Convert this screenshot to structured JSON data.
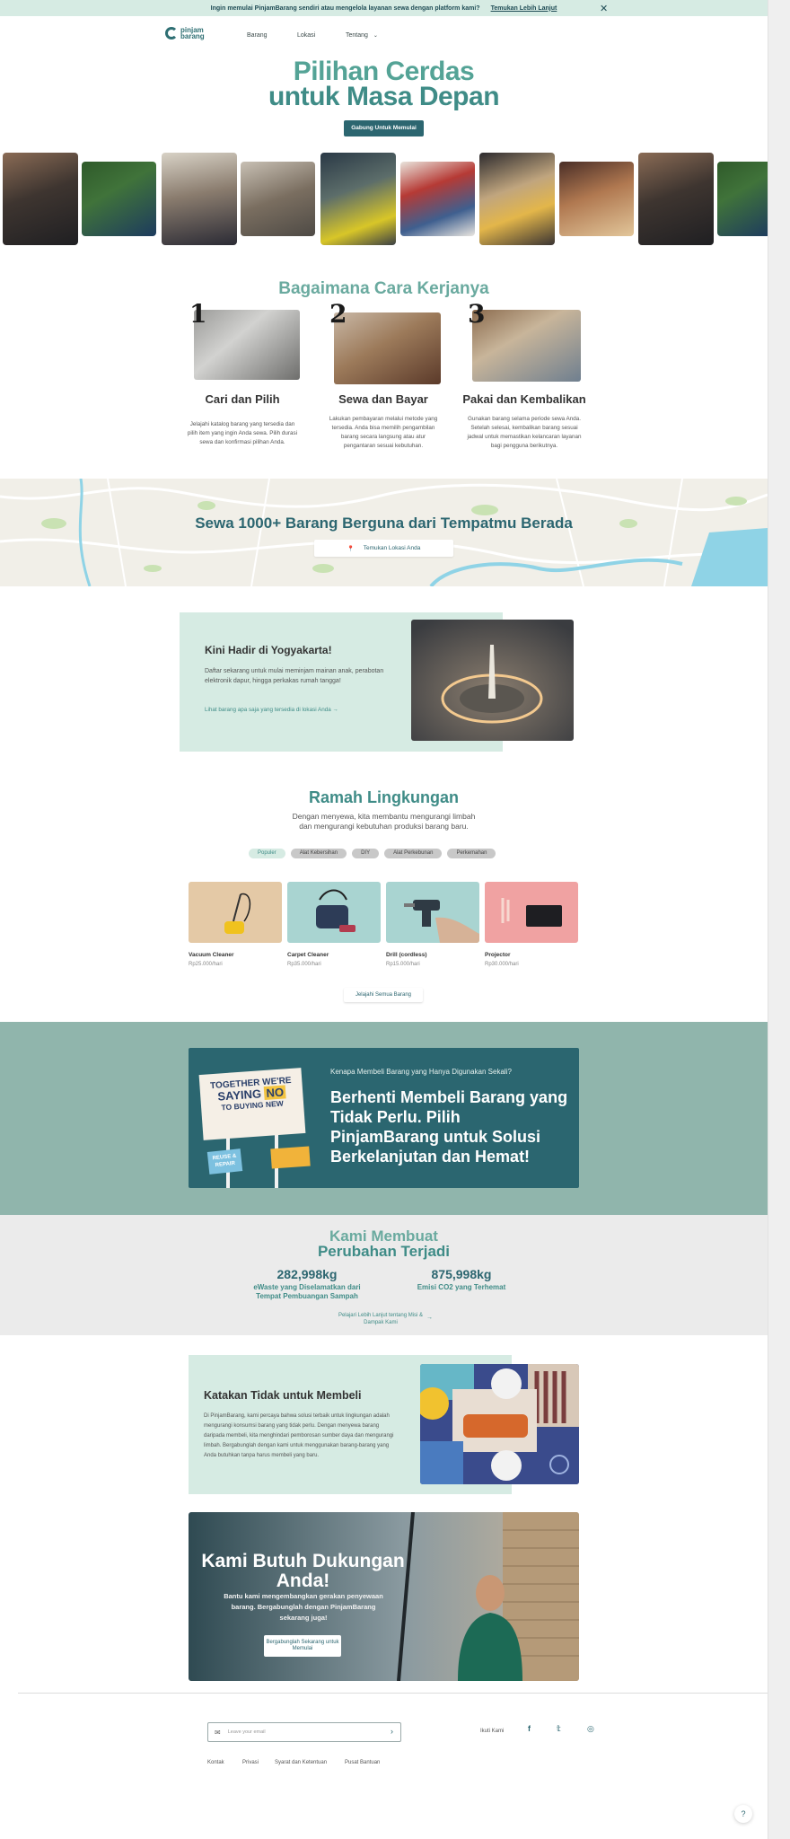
{
  "banner": {
    "text": "Ingin memulai PinjamBarang sendiri atau mengelola layanan sewa dengan platform kami?",
    "link": "Temukan Lebih Lanjut",
    "close_icon": "close-icon"
  },
  "nav": {
    "logo_line1": "pinjam",
    "logo_line2": "barang",
    "items": [
      "Barang",
      "Lokasi",
      "Tentang"
    ]
  },
  "hero": {
    "title_line1": "Pilihan Cerdas",
    "title_line2": "untuk Masa Depan",
    "cta": "Gabung Untuk Memulai"
  },
  "how": {
    "title": "Bagaimana Cara Kerjanya",
    "steps": [
      {
        "num": "1",
        "title": "Cari dan Pilih",
        "desc": "Jelajahi katalog barang yang tersedia dan pilih item yang ingin Anda sewa. Pilih durasi sewa dan konfirmasi pilihan Anda."
      },
      {
        "num": "2",
        "title": "Sewa dan Bayar",
        "desc": "Lakukan pembayaran melalui metode yang tersedia. Anda bisa memilih pengambilan barang secara langsung atau atur pengantaran sesuai kebutuhan."
      },
      {
        "num": "3",
        "title": "Pakai dan Kembalikan",
        "desc": "Gunakan barang selama periode sewa Anda. Setelah selesai, kembalikan barang sesuai jadwal untuk memastikan kelancaran layanan bagi pengguna berikutnya."
      }
    ]
  },
  "map": {
    "title": "Sewa 1000+ Barang Berguna dari Tempatmu Berada",
    "button": "Temukan Lokasi Anda"
  },
  "jogja": {
    "title": "Kini Hadir di Yogyakarta!",
    "desc": "Daftar sekarang untuk mulai meminjam mainan anak, perabotan elektronik dapur, hingga perkakas rumah tangga!",
    "link": "Lihat barang apa saja yang tersedia di lokasi Anda"
  },
  "ramah": {
    "title": "Ramah Lingkungan",
    "subtitle_line1": "Dengan menyewa, kita membantu mengurangi limbah",
    "subtitle_line2": "dan mengurangi kebutuhan produksi barang baru.",
    "filters": [
      "Populer",
      "Alat Kebersihan",
      "DIY",
      "Alat Perkebunan",
      "Perkemahan"
    ],
    "products": [
      {
        "name": "Vacuum Cleaner",
        "price": "Rp25.000/hari"
      },
      {
        "name": "Carpet Cleaner",
        "price": "Rp35.000/hari"
      },
      {
        "name": "Drill (cordless)",
        "price": "Rp15.000/hari"
      },
      {
        "name": "Projector",
        "price": "Rp30.000/hari"
      }
    ],
    "button": "Jelajahi Semua Barang"
  },
  "stop": {
    "eyebrow": "Kenapa Membeli Barang yang Hanya Digunakan Sekali?",
    "title": "Berhenti Membeli Barang yang Tidak Perlu. Pilih PinjamBarang untuk Solusi Berkelanjutan dan Hemat!",
    "sign_line1": "TOGETHER WE'RE",
    "sign_saying": "SAYING",
    "sign_no": "NO",
    "sign_line3": "TO BUYING NEW",
    "tag1": "REUSE & REPAIR"
  },
  "stats": {
    "title_line1": "Kami Membuat",
    "title_line2": "Perubahan Terjadi",
    "items": [
      {
        "value": "282,998kg",
        "label": "eWaste yang Diselamatkan dari Tempat Pembuangan Sampah"
      },
      {
        "value": "875,998kg",
        "label": "Emisi CO2 yang Terhemat"
      }
    ],
    "link": "Pelajari Lebih Lanjut tentang Misi & Dampak Kami"
  },
  "tidak": {
    "title": "Katakan Tidak untuk Membeli",
    "desc": "Di PinjamBarang, kami percaya bahwa solusi terbaik untuk lingkungan adalah mengurangi konsumsi barang yang tidak perlu. Dengan menyewa barang daripada membeli, kita menghindari pemborosan sumber daya dan mengurangi limbah. Bergabunglah dengan kami untuk menggunakan barang-barang yang Anda butuhkan tanpa harus membeli yang baru."
  },
  "support": {
    "title": "Kami Butuh Dukungan Anda!",
    "desc": "Bantu kami mengembangkan gerakan penyewaan barang. Bergabunglah dengan PinjamBarang sekarang juga!",
    "button": "Bergabunglah Sekarang untuk Memulai"
  },
  "footer": {
    "email_placeholder": "Leave your email",
    "follow": "Ikuti Kami",
    "links": [
      "Kontak",
      "Privasi",
      "Syarat dan Ketentuan",
      "Pusat Bantuan"
    ]
  },
  "colors": {
    "primary": "#2c6670",
    "accent": "#54a396",
    "mint": "#d6ebe3",
    "sage": "#90b5ac"
  }
}
